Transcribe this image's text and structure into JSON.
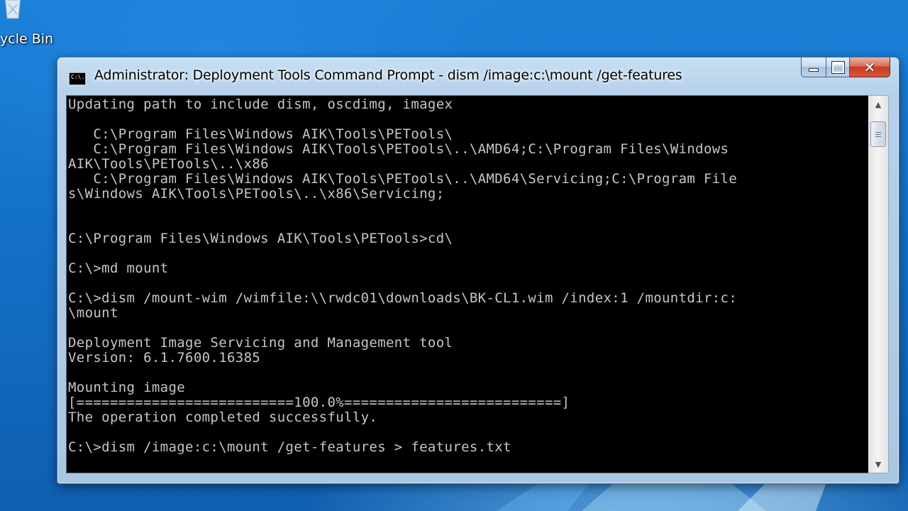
{
  "desktop": {
    "icons": [
      {
        "label": "ycle Bin",
        "icon": "recycle-bin-icon"
      }
    ]
  },
  "window": {
    "title": "Administrator: Deployment Tools Command Prompt - dism  /image:c:\\mount /get-features",
    "app_icon_text": "C:\\.",
    "controls": {
      "minimize": "minimize-icon",
      "maximize": "maximize-icon",
      "close": "close-icon",
      "close_glyph": "✕"
    }
  },
  "console": {
    "colors": {
      "background": "#000000",
      "text": "#c6c6c6"
    },
    "lines": [
      "Updating path to include dism, oscdimg, imagex",
      "",
      "   C:\\Program Files\\Windows AIK\\Tools\\PETools\\",
      "   C:\\Program Files\\Windows AIK\\Tools\\PETools\\..\\AMD64;C:\\Program Files\\Windows",
      "AIK\\Tools\\PETools\\..\\x86",
      "   C:\\Program Files\\Windows AIK\\Tools\\PETools\\..\\AMD64\\Servicing;C:\\Program File",
      "s\\Windows AIK\\Tools\\PETools\\..\\x86\\Servicing;",
      "",
      "",
      "C:\\Program Files\\Windows AIK\\Tools\\PETools>cd\\",
      "",
      "C:\\>md mount",
      "",
      "C:\\>dism /mount-wim /wimfile:\\\\rwdc01\\downloads\\BK-CL1.wim /index:1 /mountdir:c:",
      "\\mount",
      "",
      "Deployment Image Servicing and Management tool",
      "Version: 6.1.7600.16385",
      "",
      "Mounting image",
      "[==========================100.0%==========================]",
      "The operation completed successfully.",
      "",
      "C:\\>dism /image:c:\\mount /get-features > features.txt"
    ]
  },
  "scrollbar": {
    "up_arrow": "▲",
    "down_arrow": "▼"
  }
}
